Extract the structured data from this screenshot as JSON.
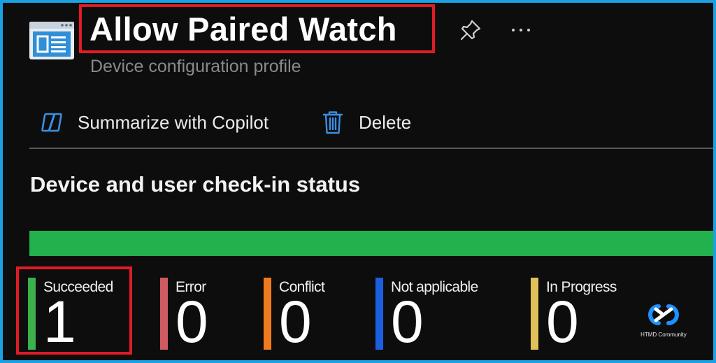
{
  "header": {
    "title": "Allow Paired Watch",
    "subtitle": "Device configuration profile",
    "icons": {
      "profile": "configuration-profile-icon",
      "pin": "pin-icon",
      "more": "more-options-icon"
    }
  },
  "toolbar": {
    "copilot_label": "Summarize with Copilot",
    "delete_label": "Delete",
    "icons": {
      "copilot": "copilot-icon",
      "delete": "trash-icon"
    }
  },
  "status_section": {
    "heading": "Device and user check-in status",
    "progress": {
      "succeeded_fraction": 1.0,
      "color": "#22b14c"
    },
    "tiles": [
      {
        "label": "Succeeded",
        "count": "1",
        "color": "#3cb04a"
      },
      {
        "label": "Error",
        "count": "0",
        "color": "#cf5a62"
      },
      {
        "label": "Conflict",
        "count": "0",
        "color": "#f07a1e"
      },
      {
        "label": "Not applicable",
        "count": "0",
        "color": "#1a5fe0"
      },
      {
        "label": "In Progress",
        "count": "0",
        "color": "#e2c058"
      }
    ]
  },
  "watermark": {
    "text": "HTMD Community",
    "logo": "htmd-logo"
  },
  "colors": {
    "background": "#0d0d0d",
    "outer_border": "#1ba1e2",
    "highlight": "#e01b24",
    "accent_blue": "#3a8fe0"
  }
}
